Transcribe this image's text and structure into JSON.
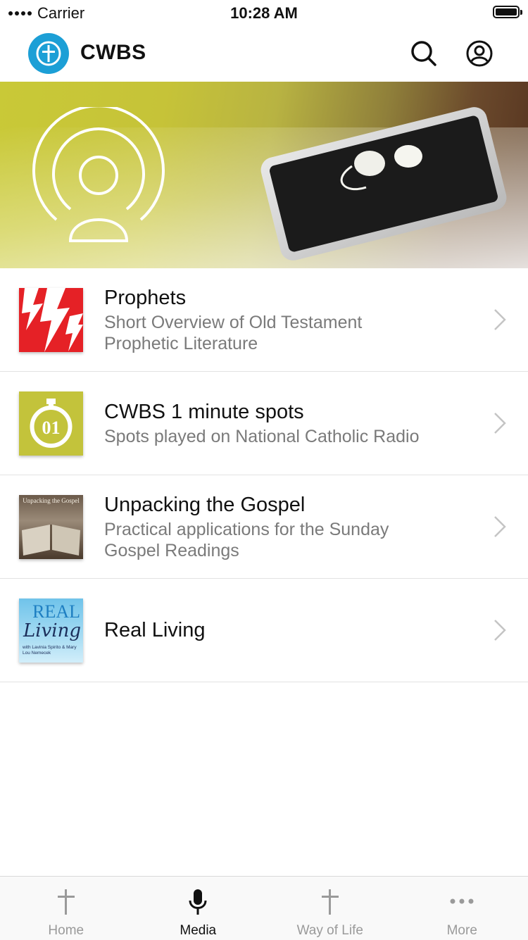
{
  "status_bar": {
    "carrier": "Carrier",
    "time": "10:28 AM"
  },
  "header": {
    "title": "CWBS",
    "logo_icon": "cross-logo-icon",
    "search_icon": "search-icon",
    "account_icon": "account-icon"
  },
  "list": [
    {
      "title": "Prophets",
      "subtitle": "Short Overview of Old Testament\nProphetic Literature",
      "thumb_color": "#e52126"
    },
    {
      "title": "CWBS 1 minute spots",
      "subtitle": "Spots played on National Catholic Radio",
      "thumb_color": "#c3c33b",
      "thumb_text": "01"
    },
    {
      "title": "Unpacking the Gospel",
      "subtitle": "Practical applications for the Sunday\nGospel Readings",
      "thumb_text": "Unpacking the Gospel"
    },
    {
      "title": "Real Living",
      "subtitle": "",
      "thumb_text_1": "REAL",
      "thumb_text_2": "Living",
      "thumb_text_3": "with Lavinia Spirito & Mary Lou Nemecek"
    }
  ],
  "tabs": [
    {
      "label": "Home",
      "icon": "cross-icon"
    },
    {
      "label": "Media",
      "icon": "microphone-icon",
      "active": true
    },
    {
      "label": "Way of Life",
      "icon": "cross-icon"
    },
    {
      "label": "More",
      "icon": "more-icon"
    }
  ],
  "colors": {
    "brand": "#1c9fd6",
    "accent_olive": "#c3c33b",
    "prophets_red": "#e52126"
  }
}
